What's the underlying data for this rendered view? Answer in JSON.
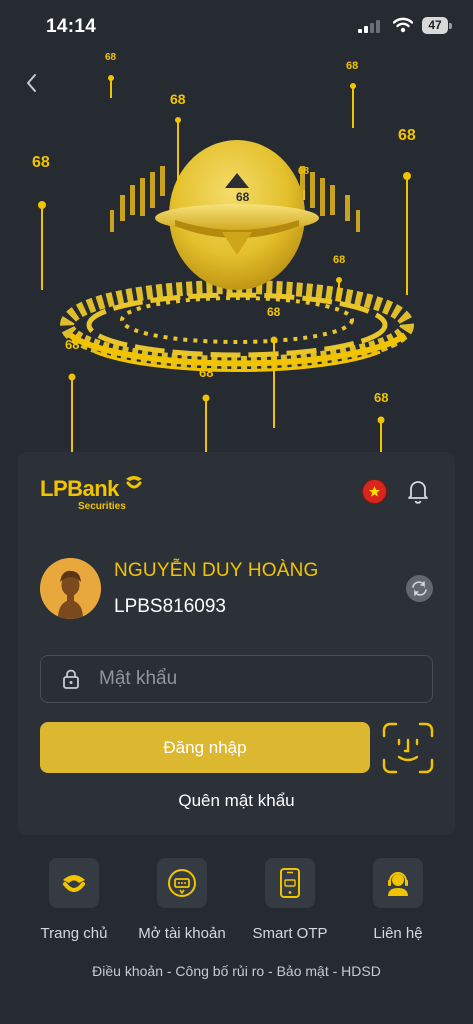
{
  "status": {
    "time": "14:14",
    "battery": "47"
  },
  "hero_badges": [
    "68",
    "68",
    "68",
    "68",
    "68",
    "68",
    "68",
    "68",
    "68",
    "68",
    "68",
    "68"
  ],
  "brand": {
    "name": "LPBank",
    "sub": "Securities"
  },
  "user": {
    "name": "NGUYỄN DUY HOÀNG",
    "id": "LPBS816093"
  },
  "password": {
    "placeholder": "Mật khẩu",
    "value": ""
  },
  "login_label": "Đăng nhập",
  "forgot_label": "Quên mật khẩu",
  "quick_actions": [
    {
      "label": "Trang chủ",
      "icon": "home-coin-icon"
    },
    {
      "label": "Mở tài khoản",
      "icon": "open-account-icon"
    },
    {
      "label": "Smart OTP",
      "icon": "smart-otp-icon"
    },
    {
      "label": "Liên hệ",
      "icon": "support-agent-icon"
    }
  ],
  "footer": "Điều khoản - Công bố rủi ro - Bảo mật - HDSD",
  "colors": {
    "accent": "#f2c400",
    "button": "#dcb730",
    "background": "#262b31",
    "card": "#2c3138"
  }
}
